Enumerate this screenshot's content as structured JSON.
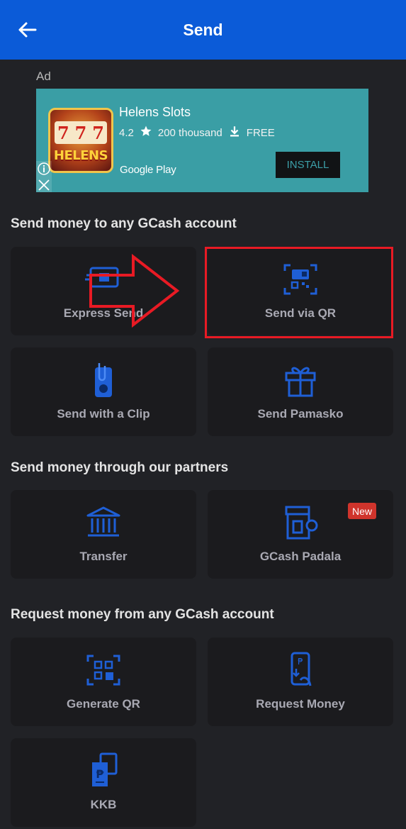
{
  "header": {
    "title": "Send"
  },
  "ad": {
    "label": "Ad",
    "app_name": "Helens Slots",
    "rating": "4.2",
    "downloads": "200 thousand",
    "price": "FREE",
    "store": "Google Play",
    "install_label": "INSTALL",
    "icon_text": "HELENS",
    "icon_sevens": [
      "7",
      "7",
      "7"
    ]
  },
  "sections": {
    "send": "Send money to any GCash account",
    "partners": "Send money through our partners",
    "request": "Request money from any GCash account"
  },
  "tiles": {
    "express_send": "Express Send",
    "send_via_qr": "Send via QR",
    "send_with_clip": "Send with a Clip",
    "send_pamasko": "Send Pamasko",
    "transfer": "Transfer",
    "gcash_padala": "GCash Padala",
    "generate_qr": "Generate QR",
    "request_money": "Request Money",
    "kkb": "KKB"
  },
  "badge_new": "New",
  "colors": {
    "header": "#0b5bd8",
    "icon_blue": "#1f5fd6",
    "highlight": "#e81a24",
    "ad_bg": "#3a9ea5"
  }
}
